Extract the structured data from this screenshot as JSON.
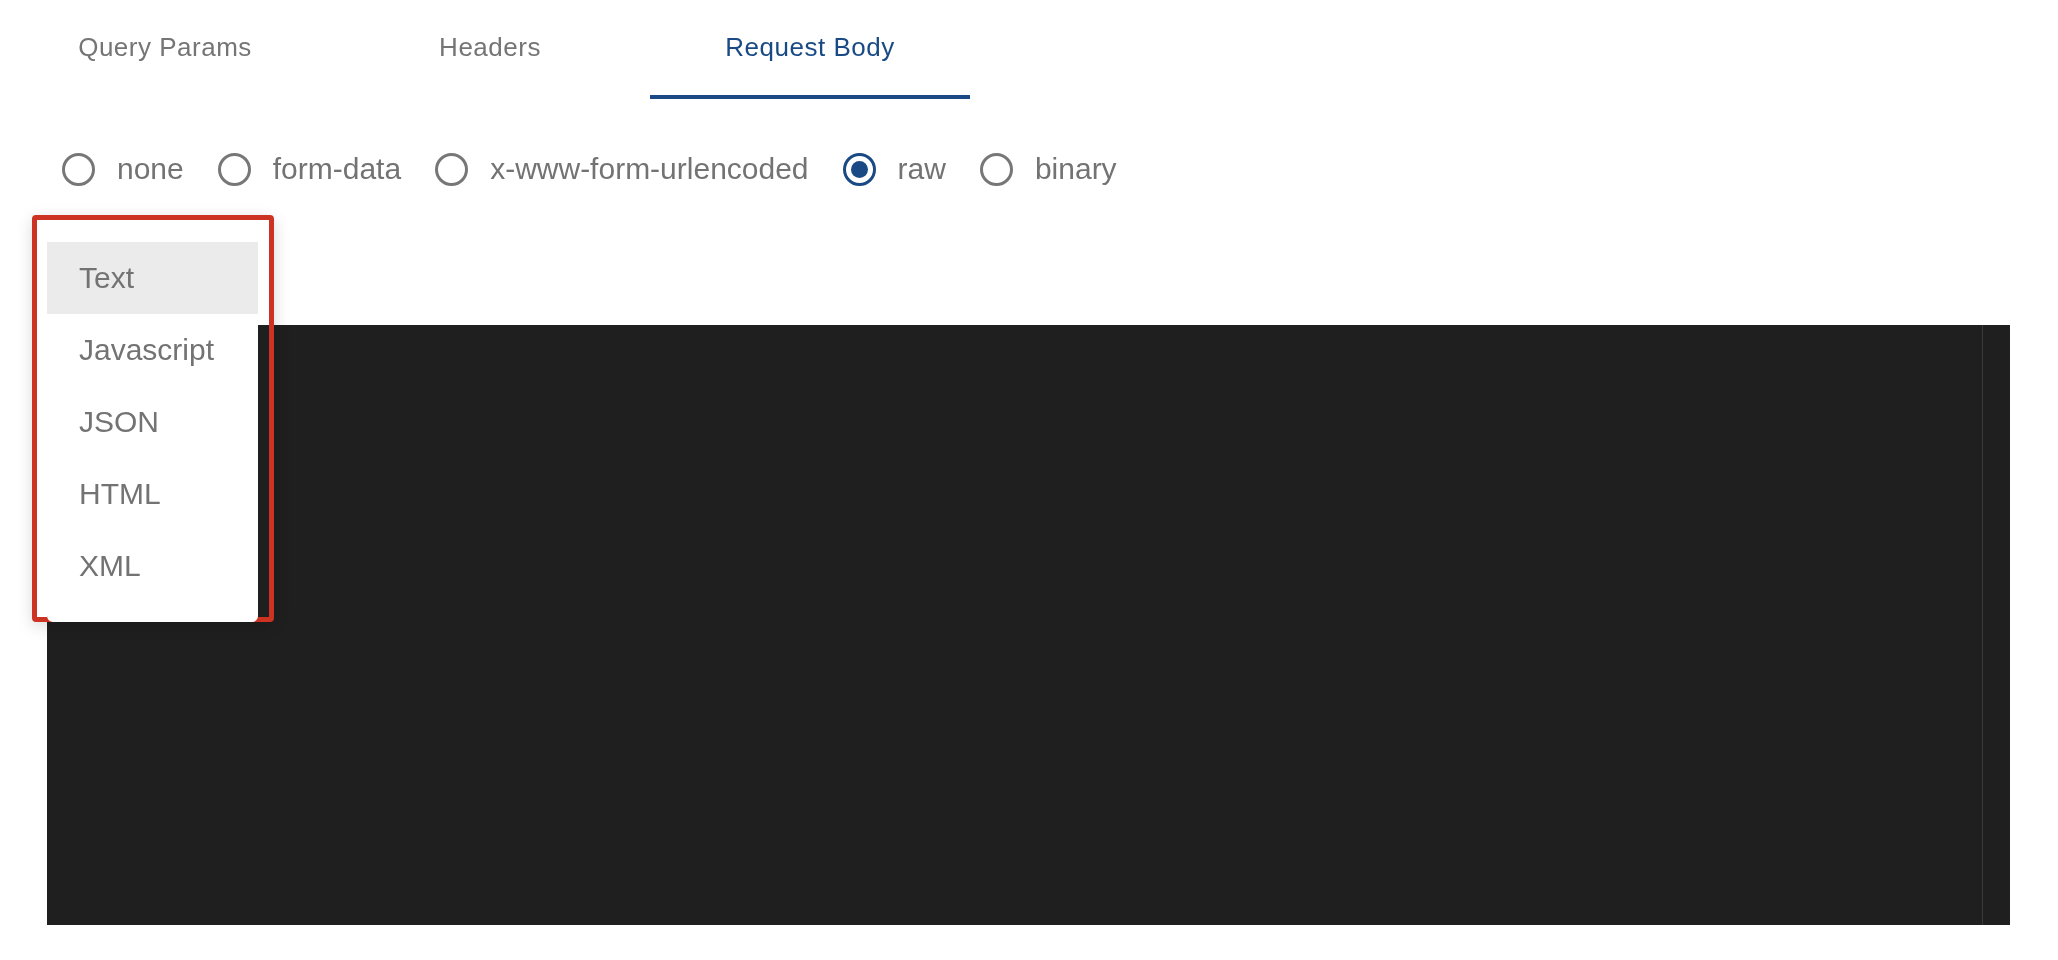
{
  "tabs": [
    {
      "label": "Query Params",
      "selected": false
    },
    {
      "label": "Headers",
      "selected": false
    },
    {
      "label": "Request Body",
      "selected": true
    }
  ],
  "body_types": [
    {
      "label": "none",
      "selected": false
    },
    {
      "label": "form-data",
      "selected": false
    },
    {
      "label": "x-www-form-urlencoded",
      "selected": false
    },
    {
      "label": "raw",
      "selected": true
    },
    {
      "label": "binary",
      "selected": false
    }
  ],
  "format_menu": {
    "highlighted": true,
    "items": [
      {
        "label": "Text",
        "selected": true
      },
      {
        "label": "Javascript",
        "selected": false
      },
      {
        "label": "JSON",
        "selected": false
      },
      {
        "label": "HTML",
        "selected": false
      },
      {
        "label": "XML",
        "selected": false
      }
    ]
  }
}
